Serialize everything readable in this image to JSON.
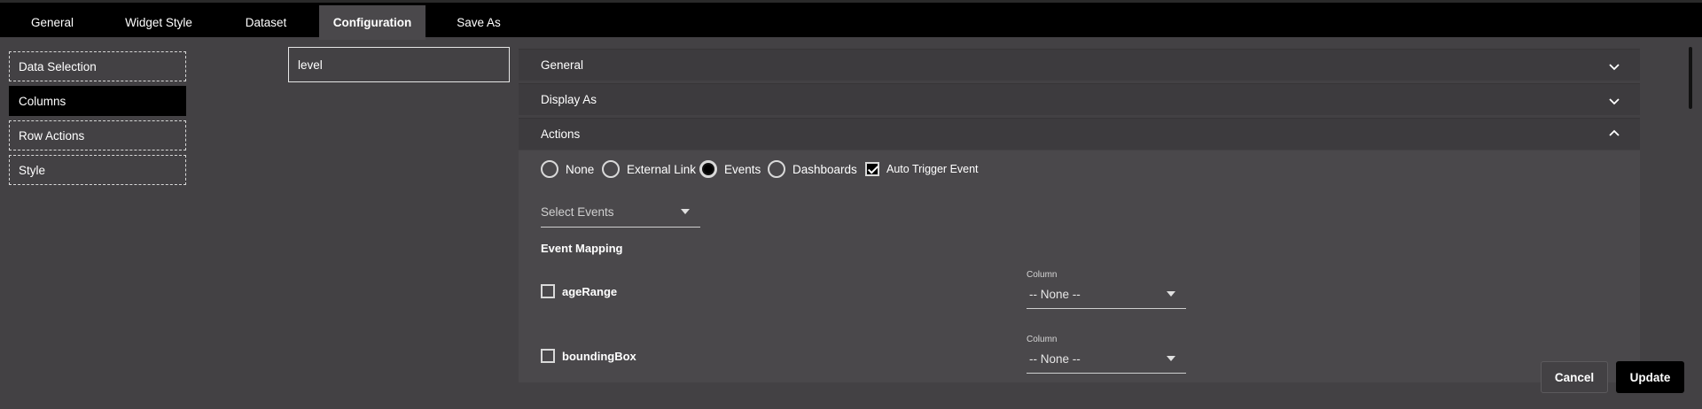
{
  "tabs": [
    {
      "label": "General"
    },
    {
      "label": "Widget Style"
    },
    {
      "label": "Dataset"
    },
    {
      "label": "Configuration"
    },
    {
      "label": "Save As"
    }
  ],
  "sidebar": {
    "items": [
      {
        "label": "Data Selection"
      },
      {
        "label": "Columns"
      },
      {
        "label": "Row Actions"
      },
      {
        "label": "Style"
      }
    ]
  },
  "search": {
    "value": "level"
  },
  "accordion": {
    "general": "General",
    "display_as": "Display As",
    "actions": "Actions"
  },
  "actions": {
    "options": [
      {
        "label": "None"
      },
      {
        "label": "External Link"
      },
      {
        "label": "Events"
      },
      {
        "label": "Dashboards"
      }
    ],
    "selected": "Events",
    "auto_trigger_label": "Auto Trigger Event",
    "select_events_placeholder": "Select Events",
    "event_mapping_title": "Event Mapping",
    "mappings": [
      {
        "name": "ageRange",
        "column_label": "Column",
        "column_value": "-- None --"
      },
      {
        "name": "boundingBox",
        "column_label": "Column",
        "column_value": "-- None --"
      }
    ]
  },
  "buttons": {
    "cancel": "Cancel",
    "update": "Update"
  }
}
